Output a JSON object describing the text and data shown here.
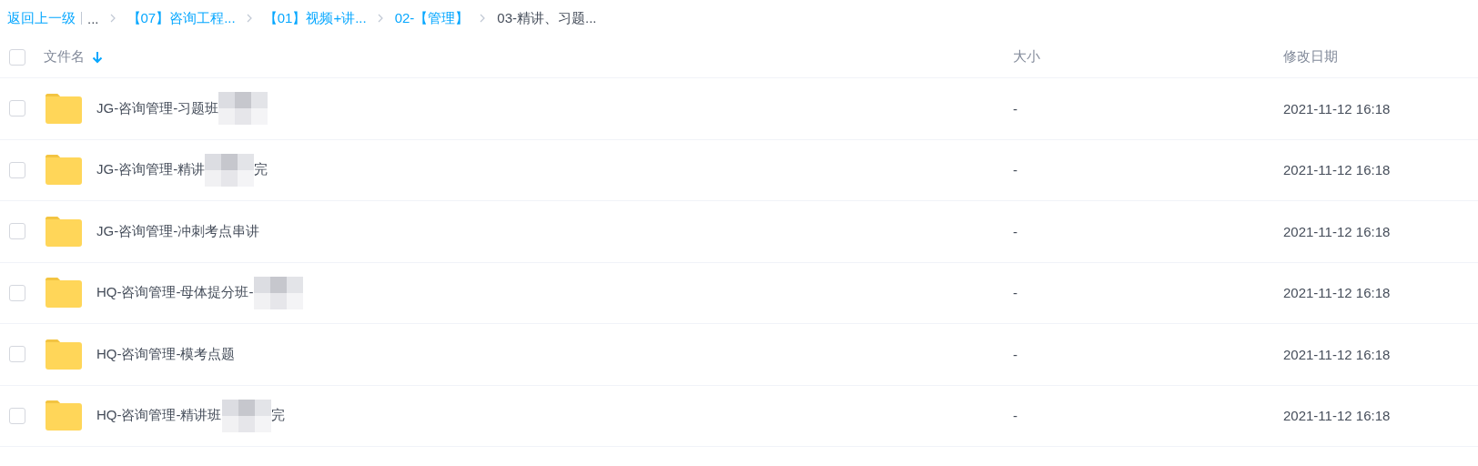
{
  "breadcrumb": {
    "back": "返回上一级",
    "items": [
      {
        "label": "...",
        "link": false
      },
      {
        "label": "【07】咨询工程...",
        "link": true
      },
      {
        "label": "【01】视频+讲...",
        "link": true
      },
      {
        "label": "02-【管理】",
        "link": true
      },
      {
        "label": "03-精讲、习题...",
        "link": false
      }
    ]
  },
  "table": {
    "columns": [
      "文件名",
      "大小",
      "修改日期"
    ],
    "all_checked": false,
    "rows": [
      {
        "name": "JG-咨询管理-习题班",
        "redacted": true,
        "suffix": "",
        "size": "-",
        "modified": "2021-11-12 16:18",
        "checked": false
      },
      {
        "name": "JG-咨询管理-精讲",
        "redacted": true,
        "suffix": "完",
        "size": "-",
        "modified": "2021-11-12 16:18",
        "checked": false
      },
      {
        "name": "JG-咨询管理-冲刺考点串讲",
        "redacted": false,
        "suffix": "",
        "size": "-",
        "modified": "2021-11-12 16:18",
        "checked": false
      },
      {
        "name": "HQ-咨询管理-母体提分班-",
        "redacted": true,
        "suffix": "",
        "size": "-",
        "modified": "2021-11-12 16:18",
        "checked": false
      },
      {
        "name": "HQ-咨询管理-模考点题",
        "redacted": false,
        "suffix": "",
        "size": "-",
        "modified": "2021-11-12 16:18",
        "checked": false
      },
      {
        "name": "HQ-咨询管理-精讲班",
        "redacted": true,
        "suffix": "完",
        "size": "-",
        "modified": "2021-11-12 16:18",
        "checked": false
      }
    ]
  }
}
